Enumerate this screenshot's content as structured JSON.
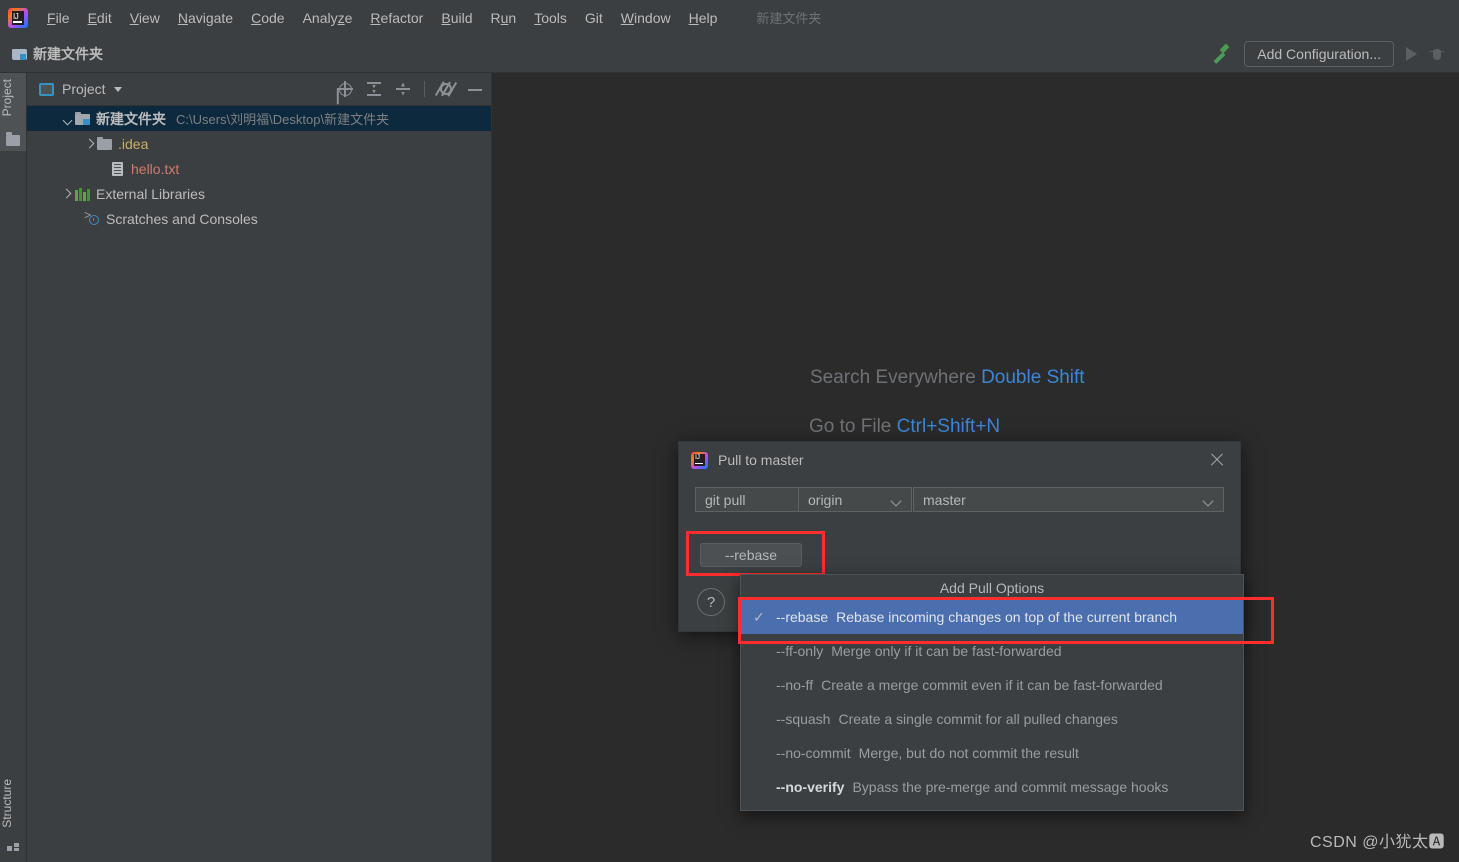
{
  "menubar": {
    "logo_icon": "intellij-logo-icon",
    "items": [
      {
        "label": "File",
        "mnemonic": "F"
      },
      {
        "label": "Edit",
        "mnemonic": "E"
      },
      {
        "label": "View",
        "mnemonic": "V"
      },
      {
        "label": "Navigate",
        "mnemonic": "N"
      },
      {
        "label": "Code",
        "mnemonic": "C"
      },
      {
        "label": "Analyze",
        "mnemonic": "z"
      },
      {
        "label": "Refactor",
        "mnemonic": "R"
      },
      {
        "label": "Build",
        "mnemonic": "B"
      },
      {
        "label": "Run",
        "mnemonic": "u"
      },
      {
        "label": "Tools",
        "mnemonic": "T"
      },
      {
        "label": "Git",
        "mnemonic": ""
      },
      {
        "label": "Window",
        "mnemonic": "W"
      },
      {
        "label": "Help",
        "mnemonic": "H"
      }
    ],
    "window_title": "新建文件夹"
  },
  "navbar": {
    "project_name": "新建文件夹",
    "folder_icon": "folder-module-icon",
    "hammer_icon": "build-hammer-icon",
    "add_configuration_label": "Add Configuration...",
    "run_icon": "run-triangle-icon",
    "debug_icon": "debug-bug-icon"
  },
  "toolstrip": {
    "project_button": "Project",
    "project_icon": "folder-icon",
    "structure_button": "Structure",
    "structure_icon": "structure-blocks-icon"
  },
  "project_panel": {
    "title": "Project",
    "title_icon": "project-window-icon",
    "caret_icon": "chevron-down-icon",
    "tools": [
      {
        "name": "scroll-from-source-icon",
        "icon": "target-icon"
      },
      {
        "name": "expand-all-icon",
        "icon": "expand-all-icon"
      },
      {
        "name": "collapse-all-icon",
        "icon": "collapse-all-icon"
      },
      {
        "name": "settings-icon",
        "icon": "gear-icon"
      },
      {
        "name": "hide-icon",
        "icon": "minus-icon"
      }
    ],
    "tree": [
      {
        "label": "新建文件夹",
        "path": "C:\\Users\\刘明福\\Desktop\\新建文件夹",
        "icon": "folder-module-icon",
        "arrow": "down",
        "selected": true,
        "indent": 0,
        "style": "bold"
      },
      {
        "label": ".idea",
        "path": "",
        "icon": "folder-icon",
        "arrow": "right",
        "selected": false,
        "indent": 1,
        "style": "yellow"
      },
      {
        "label": "hello.txt",
        "path": "",
        "icon": "file-icon",
        "arrow": "none",
        "selected": false,
        "indent": 2,
        "style": "red"
      },
      {
        "label": "External Libraries",
        "path": "",
        "icon": "library-icon",
        "arrow": "right",
        "selected": false,
        "indent": 0,
        "style": "plain"
      },
      {
        "label": "Scratches and Consoles",
        "path": "",
        "icon": "scratches-icon",
        "arrow": "none",
        "selected": false,
        "indent": 1,
        "style": "plain"
      }
    ]
  },
  "editor": {
    "shortcuts": [
      {
        "action": "Search Everywhere",
        "key": "Double Shift"
      },
      {
        "action": "Go to File",
        "key": "Ctrl+Shift+N"
      }
    ],
    "watermark": "CSDN @小犹太🅰"
  },
  "dialog": {
    "title": "Pull to master",
    "icon": "intellij-logo-icon",
    "close_icon": "close-icon",
    "command": "git pull",
    "remote": "origin",
    "branch": "master",
    "remote_caret_icon": "chevron-down-icon",
    "branch_caret_icon": "chevron-down-icon",
    "option_chip": "--rebase",
    "help_label": "?"
  },
  "popup": {
    "header": "Add Pull Options",
    "check_glyph": "✓",
    "options": [
      {
        "flag": "--rebase",
        "desc": "Rebase incoming changes on top of the current branch",
        "checked": true,
        "selected": true,
        "bold": false
      },
      {
        "flag": "--ff-only",
        "desc": "Merge only if it can be fast-forwarded",
        "checked": false,
        "selected": false,
        "bold": false
      },
      {
        "flag": "--no-ff",
        "desc": "Create a merge commit even if it can be fast-forwarded",
        "checked": false,
        "selected": false,
        "bold": false
      },
      {
        "flag": "--squash",
        "desc": "Create a single commit for all pulled changes",
        "checked": false,
        "selected": false,
        "bold": false
      },
      {
        "flag": "--no-commit",
        "desc": "Merge, but do not commit the result",
        "checked": false,
        "selected": false,
        "bold": false
      },
      {
        "flag": "--no-verify",
        "desc": "Bypass the pre-merge and commit message hooks",
        "checked": false,
        "selected": false,
        "bold": true
      }
    ]
  },
  "colors": {
    "panel_bg": "#3c3f41",
    "editor_bg": "#2b2b2b",
    "selection_blue": "#4b6eaf",
    "tree_selection": "#0d293e",
    "accent_link": "#3a87d8",
    "highlight_red": "#ff2d2d"
  }
}
